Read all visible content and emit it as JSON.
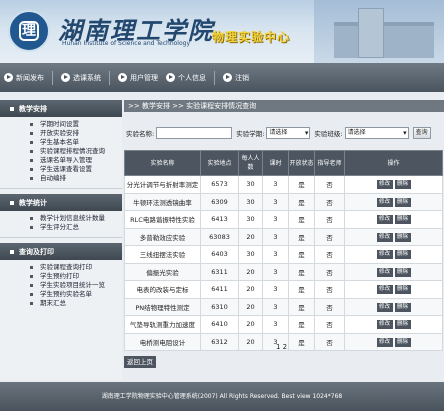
{
  "header": {
    "school_name": "湖南理工学院",
    "school_name_en": "Hunan Institute of Science and Technology",
    "system_name": "物理实验中心",
    "logo_text": "理"
  },
  "nav": {
    "items": [
      {
        "label": "新闻发布"
      },
      {
        "label": "选课系统"
      },
      {
        "label": "用户管理"
      },
      {
        "label": "个人信息"
      },
      {
        "label": "注销"
      }
    ]
  },
  "sidebar": {
    "groups": [
      {
        "title": "教学安排",
        "items": [
          "学期时间设置",
          "开放实验安排",
          "学生基本名单",
          "实验课程排程情况查询",
          "选课名单导入管理",
          "学生选课查看设置",
          "自动编排"
        ]
      },
      {
        "title": "教学统计",
        "items": [
          "教学计划信息统计数量",
          "学生评分汇总"
        ]
      },
      {
        "title": "查询及打印",
        "items": [
          "实验课程查询打印",
          "学生预约打印",
          "学生实验项目统计一览",
          "学生预约实验名单",
          "期末汇总"
        ]
      }
    ]
  },
  "breadcrumb": ">> 教学安排 >> 实验课程安排情况查询",
  "search": {
    "course_label": "实验名称:",
    "course_placeholder": "",
    "term_label": "实验学期:",
    "term_value": "请选择",
    "class_label": "实验班级:",
    "class_value": "请选择",
    "query_label": "查询"
  },
  "table": {
    "headers": [
      "实验名称",
      "实验地点",
      "每人人数",
      "课时",
      "开放状态",
      "指导老师",
      "操作"
    ],
    "op_labels": [
      "修改",
      "删除"
    ],
    "rows": [
      [
        "分光计调节与折射率测定",
        "6573",
        "30",
        "3",
        "是",
        "否"
      ],
      [
        "牛顿环法测透镜曲率",
        "6309",
        "30",
        "3",
        "是",
        "否"
      ],
      [
        "RLC电路谐振特性实验",
        "6413",
        "30",
        "3",
        "是",
        "否"
      ],
      [
        "多普勒效应实验",
        "63083",
        "20",
        "3",
        "是",
        "否"
      ],
      [
        "三线扭摆法实验",
        "6403",
        "30",
        "3",
        "是",
        "否"
      ],
      [
        "偏振光实验",
        "6311",
        "20",
        "3",
        "是",
        "否"
      ],
      [
        "电表的改装与定标",
        "6411",
        "20",
        "3",
        "是",
        "否"
      ],
      [
        "PN结物理特性测定",
        "6310",
        "20",
        "3",
        "是",
        "否"
      ],
      [
        "气垫导轨测重力加速度",
        "6410",
        "20",
        "3",
        "是",
        "否"
      ],
      [
        "电桥测电阻设计",
        "6312",
        "20",
        "3",
        "是",
        "否"
      ]
    ]
  },
  "pager": "1 2",
  "back_button": "返回上页",
  "footer": "湖南理工学院物理实验中心管理系统(2007) All Rights Reserved. Best view 1024*768"
}
